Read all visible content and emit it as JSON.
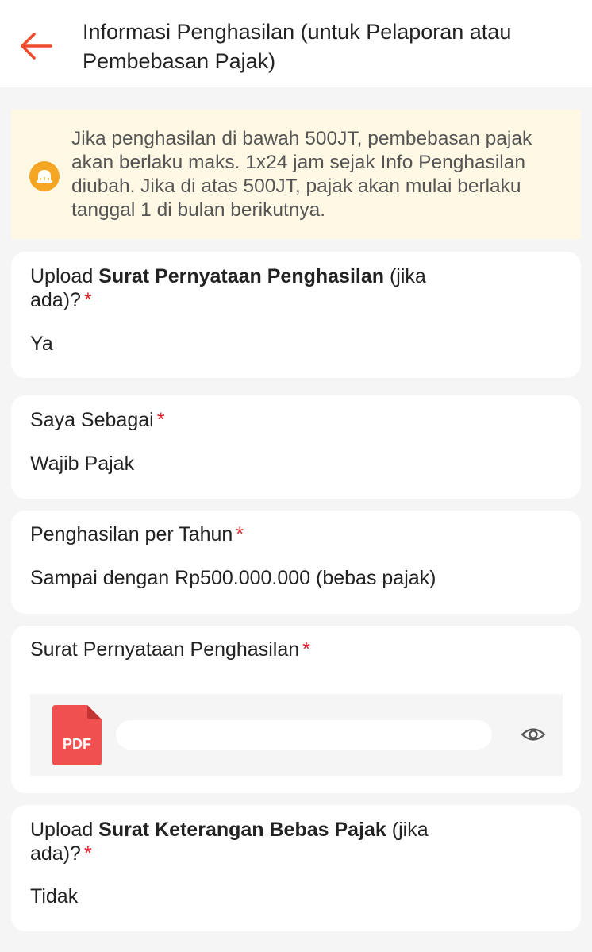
{
  "header": {
    "title": "Informasi Penghasilan (untuk Pelaporan atau Pembebasan Pajak)"
  },
  "notice": {
    "text": "Jika penghasilan di bawah 500JT, pembebasan pajak akan berlaku maks. 1x24 jam sejak Info Penghasilan diubah. Jika di atas 500JT, pajak akan mulai berlaku tanggal 1 di bulan berikutnya.",
    "icon": "bell-icon"
  },
  "fields": {
    "upload_spp": {
      "label_prefix": "Upload ",
      "label_bold": "Surat Pernyataan Penghasilan",
      "label_suffix": " (jika ada)?",
      "required": "*",
      "value": "Ya"
    },
    "saya_sebagai": {
      "label": "Saya Sebagai",
      "required": "*",
      "value": "Wajib Pajak"
    },
    "penghasilan": {
      "label": "Penghasilan per Tahun",
      "required": "*",
      "value": "Sampai dengan Rp500.000.000 (bebas pajak)"
    },
    "surat": {
      "label": "Surat Pernyataan Penghasilan",
      "required": "*",
      "file_type": "PDF"
    },
    "upload_skb": {
      "label_prefix": "Upload ",
      "label_bold": "Surat Keterangan Bebas Pajak",
      "label_suffix": " (jika ada)?",
      "required": "*",
      "value": "Tidak"
    }
  },
  "colors": {
    "accent": "#ee4d2d",
    "required": "#e0202a",
    "notice_bg": "#fff8e4",
    "notice_icon": "#f5a623",
    "pdf": "#f0504f"
  }
}
